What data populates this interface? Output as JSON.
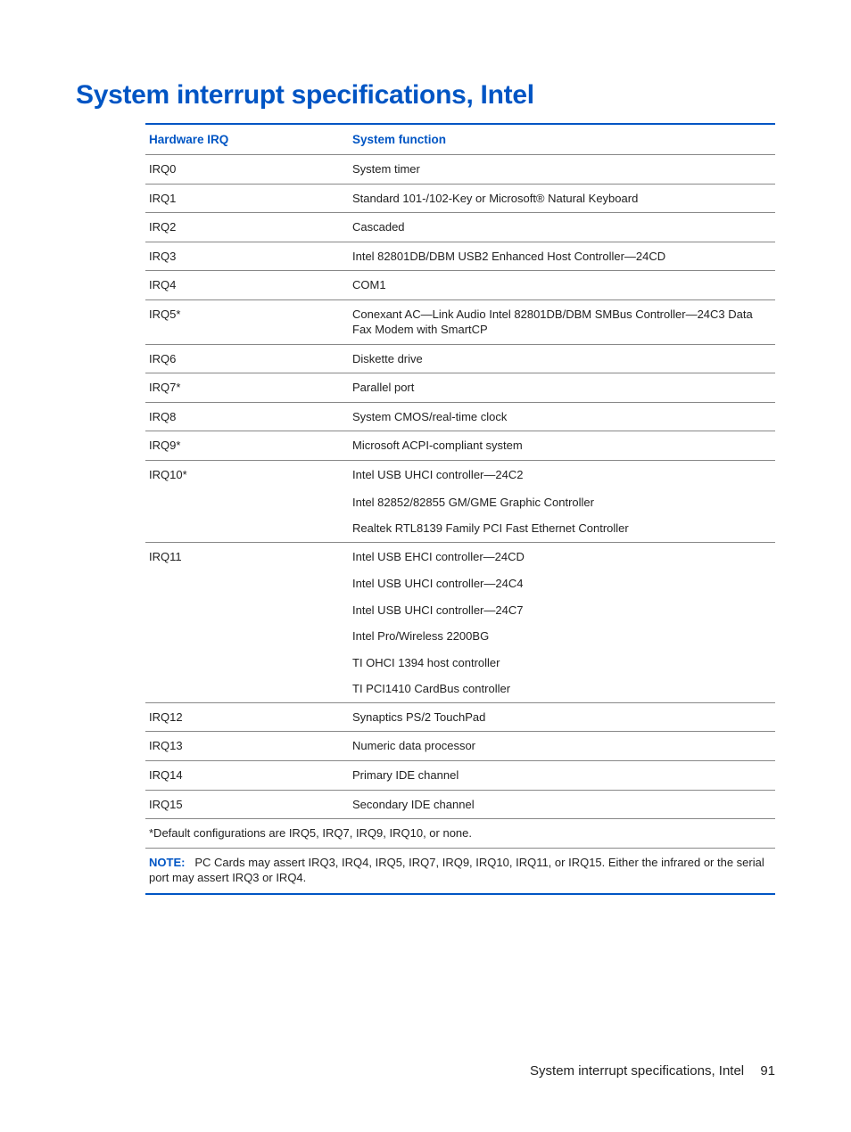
{
  "heading": "System interrupt specifications, Intel",
  "table": {
    "col1": "Hardware IRQ",
    "col2": "System function",
    "rows": [
      {
        "irq": "IRQ0",
        "funcs": [
          "System timer"
        ]
      },
      {
        "irq": "IRQ1",
        "funcs": [
          "Standard 101-/102-Key or Microsoft® Natural Keyboard"
        ]
      },
      {
        "irq": "IRQ2",
        "funcs": [
          "Cascaded"
        ]
      },
      {
        "irq": "IRQ3",
        "funcs": [
          "Intel 82801DB/DBM USB2 Enhanced Host Controller—24CD"
        ]
      },
      {
        "irq": "IRQ4",
        "funcs": [
          "COM1"
        ]
      },
      {
        "irq": "IRQ5*",
        "funcs": [
          "Conexant AC—Link Audio Intel 82801DB/DBM SMBus Controller—24C3 Data Fax Modem with SmartCP"
        ]
      },
      {
        "irq": "IRQ6",
        "funcs": [
          "Diskette drive"
        ]
      },
      {
        "irq": "IRQ7*",
        "funcs": [
          "Parallel port"
        ]
      },
      {
        "irq": "IRQ8",
        "funcs": [
          "System CMOS/real-time clock"
        ]
      },
      {
        "irq": "IRQ9*",
        "funcs": [
          "Microsoft ACPI-compliant system"
        ]
      },
      {
        "irq": "IRQ10*",
        "funcs": [
          "Intel USB UHCI controller—24C2",
          "Intel 82852/82855 GM/GME Graphic Controller",
          "Realtek RTL8139 Family PCI Fast Ethernet Controller"
        ]
      },
      {
        "irq": "IRQ11",
        "funcs": [
          "Intel USB EHCI controller—24CD",
          "Intel USB UHCI controller—24C4",
          "Intel USB UHCI controller—24C7",
          "Intel Pro/Wireless 2200BG",
          "TI OHCI 1394 host controller",
          "TI PCI1410 CardBus controller"
        ]
      },
      {
        "irq": "IRQ12",
        "funcs": [
          "Synaptics PS/2 TouchPad"
        ]
      },
      {
        "irq": "IRQ13",
        "funcs": [
          "Numeric data processor"
        ]
      },
      {
        "irq": "IRQ14",
        "funcs": [
          "Primary IDE channel"
        ]
      },
      {
        "irq": "IRQ15",
        "funcs": [
          "Secondary IDE channel"
        ]
      }
    ],
    "footnote": "*Default configurations are IRQ5, IRQ7, IRQ9, IRQ10, or none."
  },
  "note": {
    "label": "NOTE:",
    "text": "PC Cards may assert IRQ3, IRQ4, IRQ5, IRQ7, IRQ9, IRQ10, IRQ11, or IRQ15. Either the infrared or the serial port may assert IRQ3 or IRQ4."
  },
  "footer": {
    "text": "System interrupt specifications, Intel",
    "page": "91"
  }
}
